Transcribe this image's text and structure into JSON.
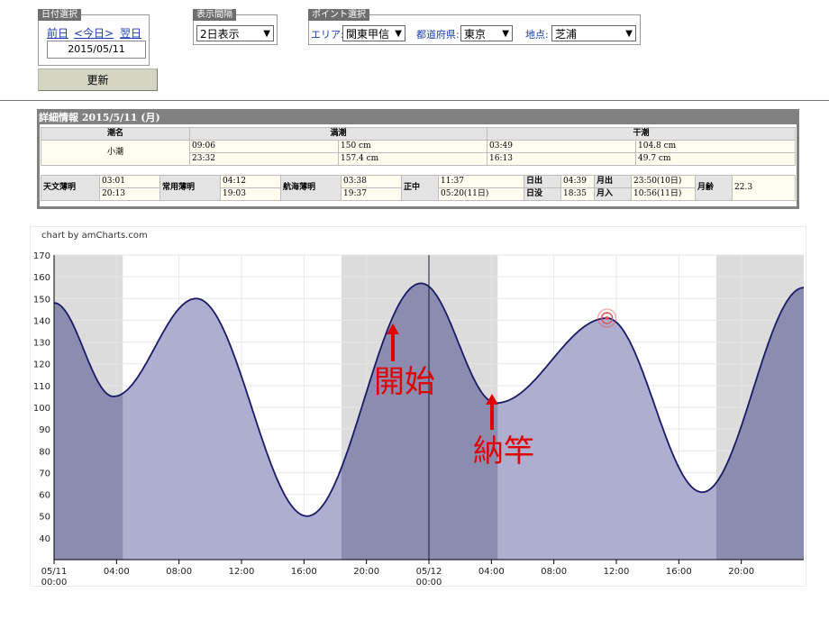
{
  "date_select": {
    "label": "日付選択",
    "prev": "前日",
    "today": "<今日>",
    "next": "翌日",
    "date_value": "2015/05/11"
  },
  "display_interval": {
    "label": "表示間隔",
    "value": "2日表示"
  },
  "point_select": {
    "label": "ポイント選択",
    "area_label": "エリア:",
    "area_value": "関東甲信",
    "pref_label": "都道府県:",
    "pref_value": "東京",
    "spot_label": "地点:",
    "spot_value": "芝浦"
  },
  "update_button": "更新",
  "detail": {
    "title": "詳細情報  2015/5/11 (月)",
    "headers": {
      "tide_name": "潮名",
      "high": "満潮",
      "low": "干潮"
    },
    "tide_name": "小潮",
    "high_rows": [
      [
        "09:06",
        "150 cm"
      ],
      [
        "23:32",
        "157.4 cm"
      ]
    ],
    "low_rows": [
      [
        "03:49",
        "104.8 cm"
      ],
      [
        "16:13",
        "49.7 cm"
      ]
    ],
    "sun": {
      "astro_twilight": {
        "label": "天文薄明",
        "v1": "03:01",
        "v2": "20:13"
      },
      "civil_twilight": {
        "label": "常用薄明",
        "v1": "04:12",
        "v2": "19:03"
      },
      "nautical_twilight": {
        "label": "航海薄明",
        "v1": "03:38",
        "v2": "19:37"
      },
      "noon": {
        "label": "正中",
        "v1": "11:37",
        "v2": "05:20(11日)"
      },
      "sunrise": {
        "label": "日出",
        "value": "04:39"
      },
      "sunset": {
        "label": "日没",
        "value": "18:35"
      },
      "moonrise": {
        "label": "月出",
        "value": "23:50(10日)"
      },
      "moonset": {
        "label": "月入",
        "value": "10:56(11日)"
      },
      "moon_age": {
        "label": "月齢",
        "value": "22.3"
      }
    }
  },
  "chart_credit": "chart by amCharts.com",
  "chart_data": {
    "type": "area",
    "x_unit": "hours from 05/11 00:00",
    "ylim": [
      30,
      170
    ],
    "xlim": [
      0,
      48
    ],
    "y_ticks": [
      40,
      50,
      60,
      70,
      80,
      90,
      100,
      110,
      120,
      130,
      140,
      150,
      160,
      170
    ],
    "x_ticks": [
      {
        "x": 0,
        "label": "05/11",
        "label2": "00:00"
      },
      {
        "x": 4,
        "label": "04:00"
      },
      {
        "x": 8,
        "label": "08:00"
      },
      {
        "x": 12,
        "label": "12:00"
      },
      {
        "x": 16,
        "label": "16:00"
      },
      {
        "x": 20,
        "label": "20:00"
      },
      {
        "x": 24,
        "label": "05/12",
        "label2": "00:00"
      },
      {
        "x": 28,
        "label": "04:00"
      },
      {
        "x": 32,
        "label": "08:00"
      },
      {
        "x": 36,
        "label": "12:00"
      },
      {
        "x": 40,
        "label": "16:00"
      },
      {
        "x": 44,
        "label": "20:00"
      }
    ],
    "night_bands": [
      [
        0,
        4.4
      ],
      [
        18.4,
        28.4
      ],
      [
        42.4,
        48
      ]
    ],
    "extremes": [
      {
        "x": 0,
        "y": 148
      },
      {
        "x": 3.8,
        "y": 105
      },
      {
        "x": 9.1,
        "y": 150
      },
      {
        "x": 16.2,
        "y": 50
      },
      {
        "x": 23.5,
        "y": 157
      },
      {
        "x": 28.3,
        "y": 102
      },
      {
        "x": 35.4,
        "y": 141
      },
      {
        "x": 41.5,
        "y": 61
      },
      {
        "x": 48,
        "y": 155
      }
    ],
    "cursor_x": 24,
    "marker": {
      "x": 35.4,
      "y": 141
    },
    "colors": {
      "fill_day": "#aeaed0",
      "fill_night": "#8c8cb0",
      "band": "#dcdcdc",
      "line": "#1a1a66",
      "marker": "#e0505a"
    }
  },
  "annotations": [
    {
      "text": "開始"
    },
    {
      "text": "納竿"
    }
  ],
  "annotation_color": "#e00000"
}
